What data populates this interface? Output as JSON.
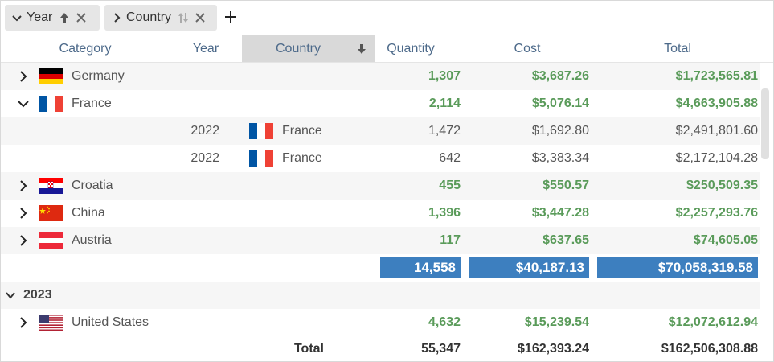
{
  "group_panel": {
    "chips": [
      {
        "label": "Year"
      },
      {
        "label": "Country"
      }
    ]
  },
  "columns": {
    "category": "Category",
    "year": "Year",
    "country": "Country",
    "quantity": "Quantity",
    "cost": "Cost",
    "total": "Total"
  },
  "rows": [
    {
      "name": "Germany",
      "quantity": "1,307",
      "cost": "$3,687.26",
      "total": "$1,723,565.81"
    },
    {
      "name": "France",
      "quantity": "2,114",
      "cost": "$5,076.14",
      "total": "$4,663,905.88"
    },
    {
      "year": "2022",
      "country": "France",
      "quantity": "1,472",
      "cost": "$1,692.80",
      "total": "$2,491,801.60"
    },
    {
      "year": "2022",
      "country": "France",
      "quantity": "642",
      "cost": "$3,383.34",
      "total": "$2,172,104.28"
    },
    {
      "name": "Croatia",
      "quantity": "455",
      "cost": "$550.57",
      "total": "$250,509.35"
    },
    {
      "name": "China",
      "quantity": "1,396",
      "cost": "$3,447.28",
      "total": "$2,257,293.76"
    },
    {
      "name": "Austria",
      "quantity": "117",
      "cost": "$637.65",
      "total": "$74,605.05"
    }
  ],
  "group_summary": {
    "quantity": "14,558",
    "cost": "$40,187.13",
    "total": "$70,058,319.58"
  },
  "group_2023": {
    "label": "2023"
  },
  "us_row": {
    "name": "United States",
    "quantity": "4,632",
    "cost": "$15,239.54",
    "total": "$12,072,612.94"
  },
  "footer": {
    "label": "Total",
    "quantity": "55,347",
    "cost": "$162,393.24",
    "total": "$162,506,308.88"
  },
  "colors": {
    "accent": "#3d7fbf",
    "green": "#5a9b5a",
    "header_text": "#4d6a8a"
  }
}
